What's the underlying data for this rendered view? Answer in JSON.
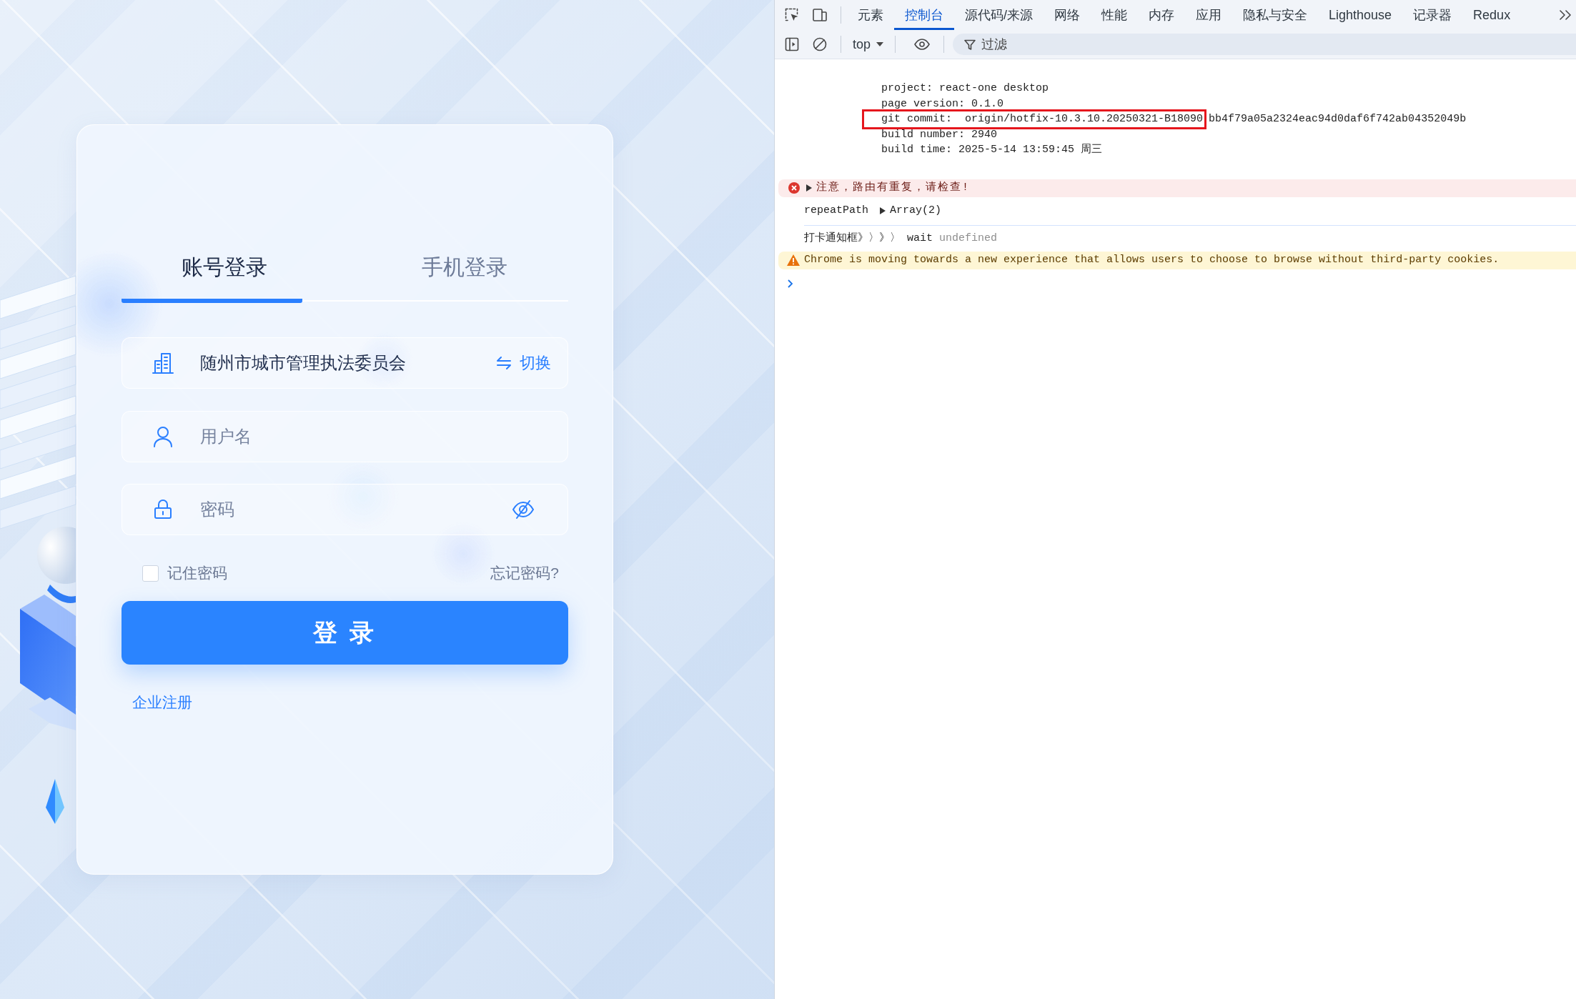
{
  "login": {
    "tabs": [
      {
        "label": "账号登录",
        "selected": true
      },
      {
        "label": "手机登录",
        "selected": false
      }
    ],
    "organization": {
      "value": "随州市城市管理执法委员会",
      "action": "切换"
    },
    "username": {
      "placeholder": "用户名"
    },
    "password": {
      "placeholder": "密码",
      "visible": false
    },
    "remember": {
      "label": "记住密码",
      "checked": false
    },
    "forgot_link": "忘记密码?",
    "submit_button": "登 录",
    "register_link": "企业注册"
  },
  "devtools": {
    "tabs": [
      {
        "label": "元素",
        "selected": false
      },
      {
        "label": "控制台",
        "selected": true
      },
      {
        "label": "源代码/来源",
        "selected": false
      },
      {
        "label": "网络",
        "selected": false
      },
      {
        "label": "性能",
        "selected": false
      },
      {
        "label": "内存",
        "selected": false
      },
      {
        "label": "应用",
        "selected": false
      },
      {
        "label": "隐私与安全",
        "selected": false
      },
      {
        "label": "Lighthouse",
        "selected": false
      },
      {
        "label": "记录器",
        "selected": false
      },
      {
        "label": "Redux",
        "selected": false
      }
    ],
    "context": "top",
    "filter": {
      "placeholder": "过滤"
    },
    "messages": [
      {
        "kind": "lines",
        "lines": [
          {
            "text": "project: react-one desktop",
            "highlighted": false
          },
          {
            "text": "page version: 0.1.0",
            "highlighted": false
          },
          {
            "text": "git commit:  origin/hotfix-10.3.10.20250321-B18090",
            "rest": "bb4f79a05a2324eac94d0daf6f742ab04352049b",
            "highlighted": true
          },
          {
            "text": "build number: 2940",
            "highlighted": false
          },
          {
            "text": "build time: 2025-5-14 13:59:45 周三",
            "highlighted": false
          }
        ]
      },
      {
        "kind": "error",
        "text": "注意，路由有重复，请检查!",
        "expanded": false
      },
      {
        "kind": "object",
        "label": "repeatPath",
        "value": "Array(2)",
        "expanded": false
      },
      {
        "kind": "log",
        "args": [
          {
            "kind": "string",
            "text": "打卡通知框》〉》〉"
          },
          {
            "kind": "string",
            "text": "wait"
          },
          {
            "kind": "undefined",
            "text": "undefined"
          }
        ]
      },
      {
        "kind": "warning",
        "text": "Chrome is moving towards a new experience that allows users to choose to browse without third-party cookies."
      }
    ]
  }
}
